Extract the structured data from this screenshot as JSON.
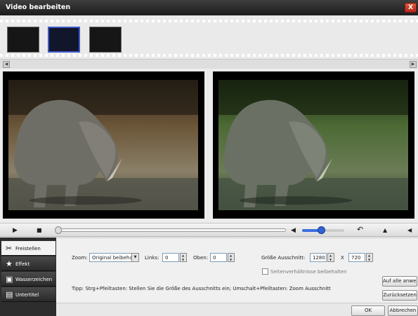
{
  "window": {
    "title": "Video bearbeiten",
    "close_label": "X"
  },
  "sidebar": {
    "items": [
      {
        "label": "Freistellen",
        "icon": "crop-icon",
        "active": true
      },
      {
        "label": "Effekt",
        "icon": "star-icon",
        "active": false
      },
      {
        "label": "Wasserzeichen",
        "icon": "watermark-icon",
        "active": false
      },
      {
        "label": "Untertitel",
        "icon": "subtitle-icon",
        "active": false
      }
    ]
  },
  "crop": {
    "zoom_label": "Zoom:",
    "zoom_value": "Original beibehal",
    "left_label": "Links:",
    "left_value": "0",
    "top_label": "Oben:",
    "top_value": "0",
    "size_label": "Größe Ausschnitt:",
    "width_value": "1280",
    "separator": "X",
    "height_value": "720",
    "keep_ratio_label": "Seitenverhältnisse beibehalten",
    "tip": "Tipp:  Strg+Pfeiltasten: Stellen Sie die Größe des Ausschnitts ein; Umschalt+Pfeiltasten: Zoom Ausschnitt",
    "apply_all_label": "Auf alle anwenden",
    "reset_label": "Zurücksetzen"
  },
  "footer": {
    "ok_label": "OK",
    "cancel_label": "Abbrechen"
  },
  "player": {
    "volume_level": 0.45,
    "position": 0.0
  },
  "colors": {
    "accent": "#3b6ee0",
    "title_bar": "#2a2a2a",
    "sidebar": "#2d2d2d",
    "close": "#c83a26"
  }
}
